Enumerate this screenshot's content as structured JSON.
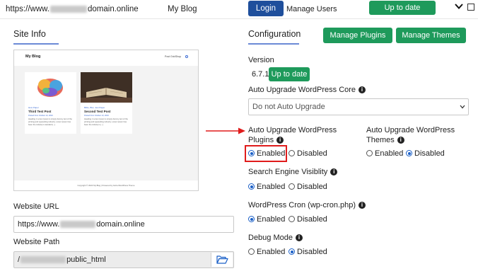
{
  "topbar": {
    "url_prefix": "https://www.",
    "url_suffix": "domain.online",
    "site_name": "My Blog",
    "login_label": "Login",
    "manage_users_label": "Manage Users",
    "status_label": "Up to date"
  },
  "site_info": {
    "title": "Site Info",
    "preview": {
      "blog_title": "My Blog",
      "nav": [
        "Post Grid",
        "Shop"
      ],
      "posts": [
        {
          "category": "Hew Paper",
          "title": "Third Test Post",
          "meta": "Posted from October 13, 2024",
          "excerpt": "Heading 1 Lorem Ipsum is simply dummy text of the printing and typesetting industry. Lorem Ipsum has been the industry's standard [...]"
        },
        {
          "category": "Bible, Blur, Jew Paper",
          "title": "Second Test Post",
          "meta": "Posted from October 13, 2024",
          "excerpt": "Heading 1 Lorem Ipsum is simply dummy text of the printing and typesetting industry. Lorem Ipsum has been the industry's [...]"
        }
      ],
      "footer": "Copyright © 2024 My Blog | Powered by Astra WordPress Theme"
    },
    "website_url_label": "Website URL",
    "website_url_prefix": "https://www.",
    "website_url_suffix": "domain.online",
    "website_path_label": "Website Path",
    "website_path_prefix": "/",
    "website_path_suffix": "public_html"
  },
  "config": {
    "title": "Configuration",
    "manage_plugins_label": "Manage Plugins",
    "manage_themes_label": "Manage Themes",
    "version_label": "Version",
    "version_value": "6.7.1",
    "version_status": "Up to date",
    "auto_core_label": "Auto Upgrade WordPress Core",
    "auto_core_value": "Do not Auto Upgrade",
    "auto_plugins_label_1": "Auto Upgrade WordPress",
    "auto_plugins_label_2": "Plugins",
    "auto_themes_label_1": "Auto Upgrade WordPress",
    "auto_themes_label_2": "Themes",
    "search_label": "Search Engine Visiblity",
    "cron_label": "WordPress Cron (wp-cron.php)",
    "debug_label": "Debug Mode",
    "enabled": "Enabled",
    "disabled": "Disabled"
  },
  "colors": {
    "blue": "#1f4f9c",
    "green": "#1e9a5b",
    "annotation_red": "#e01b1b"
  }
}
